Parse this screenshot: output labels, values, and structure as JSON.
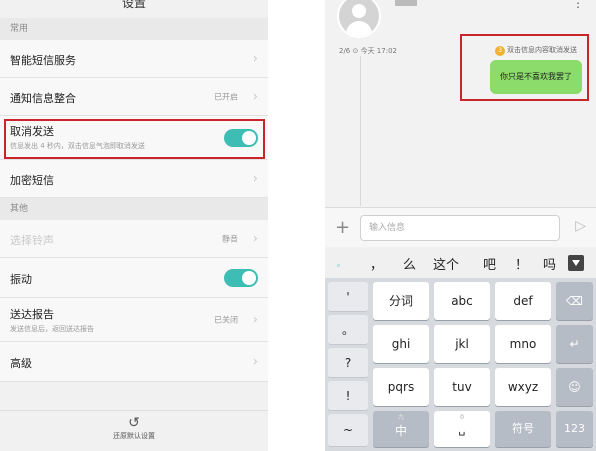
{
  "settings": {
    "title": "设置",
    "section_common": "常用",
    "section_other": "其他",
    "rows": {
      "smart": {
        "label": "智能短信服务"
      },
      "notify": {
        "label": "通知信息整合",
        "value": "已开启"
      },
      "cancel": {
        "label": "取消发送",
        "sub": "信息发出 4 秒内，双击信息气泡即取消发送",
        "toggle": "on"
      },
      "encrypt": {
        "label": "加密短信"
      },
      "ringtone": {
        "label": "选择铃声",
        "value": "静音"
      },
      "vibrate": {
        "label": "振动",
        "toggle": "on"
      },
      "report": {
        "label": "送达报告",
        "sub": "发送信息后，返回送达报告",
        "value": "已关闭"
      },
      "advanced": {
        "label": "高级"
      }
    },
    "reset_label": "还原默认设置",
    "chevron": "›",
    "accent": "#3dbdb3",
    "highlight": "#c8262b"
  },
  "chat": {
    "meta": "2/6 ⊙ 今天 17:02",
    "hint_num": "3",
    "hint": "双击信息内容取消发送",
    "bubble": "你只是不喜欢我罢了",
    "input_placeholder": "输入信息",
    "plus": "+",
    "send": "▷",
    "more": "⋮"
  },
  "keyboard": {
    "candidates": [
      "。",
      "，",
      "么",
      "这个",
      "吧",
      "！",
      "吗"
    ],
    "left_col": [
      "'",
      "。",
      "?",
      "!",
      "~"
    ],
    "rows": [
      [
        "分词",
        "abc",
        "def"
      ],
      [
        "ghi",
        "jkl",
        "mno"
      ],
      [
        "pqrs",
        "tuv",
        "wxyz"
      ]
    ],
    "small": {
      "zh": "九",
      "space": "0",
      "num_label": "123",
      "zh_label": "中",
      "sym": "符号"
    },
    "right_col": [
      "⌫",
      "↵",
      "☺",
      "123"
    ],
    "space": "␣"
  }
}
